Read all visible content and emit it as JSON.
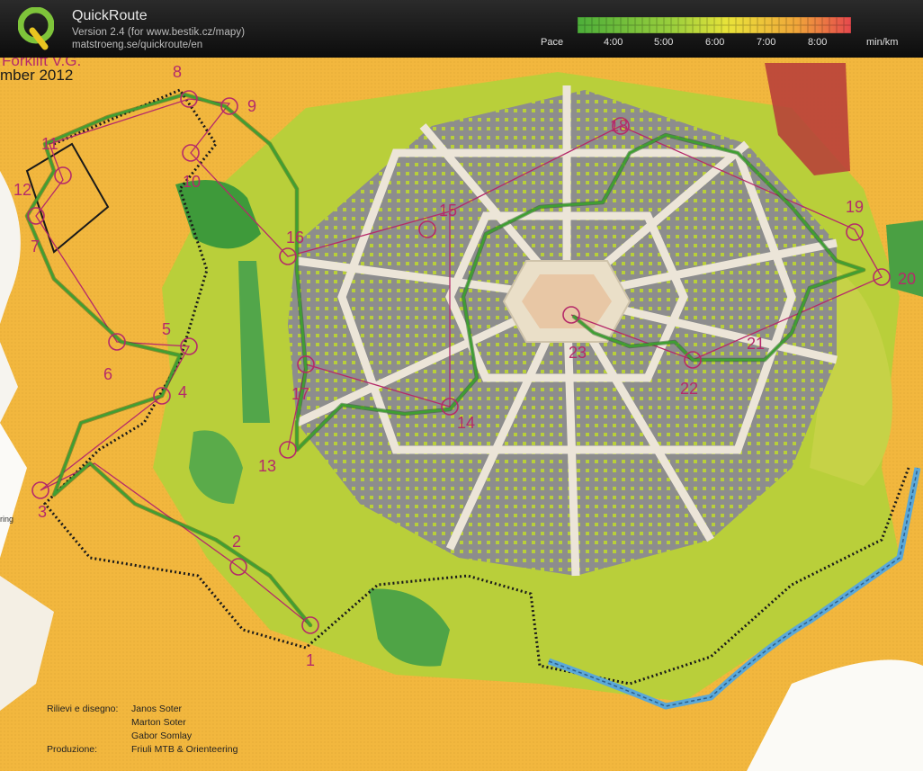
{
  "header": {
    "title": "QuickRoute",
    "version": "Version 2.4  (for www.bestik.cz/mapy)",
    "url": "matstroeng.se/quickroute/en",
    "pace_label": "Pace",
    "pace_ticks": [
      "4:00",
      "5:00",
      "6:00",
      "7:00",
      "8:00"
    ],
    "pace_unit": "min/km",
    "colors": {
      "fast": "#4cae3a",
      "mid": "#e9e33a",
      "slow": "#e5484d"
    }
  },
  "map": {
    "event_text": [
      "Forklift V.G.",
      "mber 2012"
    ],
    "controls": [
      "1",
      "2",
      "3",
      "4",
      "5",
      "6",
      "7",
      "8",
      "9",
      "10",
      "11",
      "12",
      "13",
      "14",
      "15",
      "16",
      "17",
      "18",
      "19",
      "20",
      "21",
      "22",
      "23"
    ],
    "left_label": "ring",
    "credits": [
      {
        "key": "Rilievi e disegno:",
        "value": "Janos Soter"
      },
      {
        "key": "",
        "value": "Marton Soter"
      },
      {
        "key": "",
        "value": "Gabor Somlay"
      },
      {
        "key": "Produzione:",
        "value": "Friuli MTB & Orienteering"
      }
    ],
    "colors": {
      "open_land": "#f2b73e",
      "green": "#b7cf3b",
      "forest": "#3d9a3c",
      "building": "#8c8c8c",
      "road": "#e8e0d3",
      "course": "#b52a6a",
      "route": "#3f9f33",
      "water": "#5aa8d8"
    }
  }
}
